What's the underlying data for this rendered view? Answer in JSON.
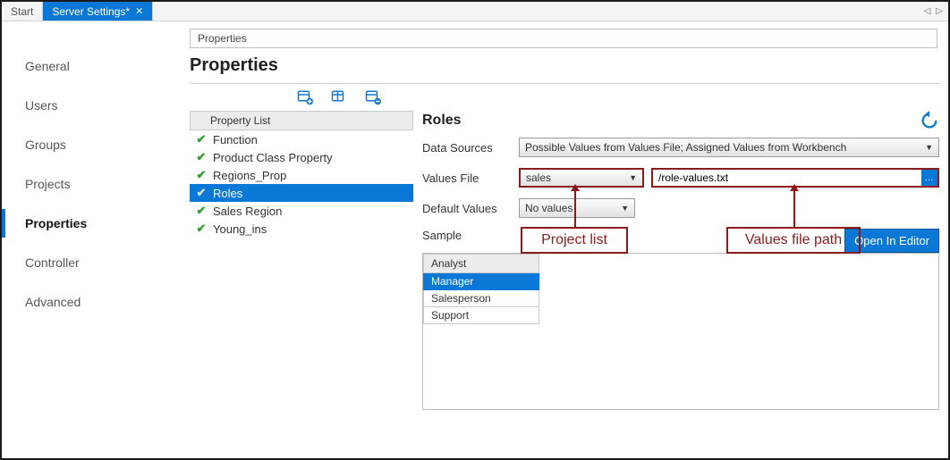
{
  "tabs": {
    "start": "Start",
    "settings": "Server Settings*"
  },
  "sidebar": {
    "items": [
      {
        "label": "General"
      },
      {
        "label": "Users"
      },
      {
        "label": "Groups"
      },
      {
        "label": "Projects"
      },
      {
        "label": "Properties"
      },
      {
        "label": "Controller"
      },
      {
        "label": "Advanced"
      }
    ],
    "active_index": 4
  },
  "breadcrumb": "Properties",
  "page_title": "Properties",
  "toolbar": {
    "add_icon": "add-table-icon",
    "edit_icon": "edit-table-icon",
    "remove_icon": "remove-table-icon"
  },
  "property_list": {
    "header": "Property List",
    "items": [
      {
        "label": "Function"
      },
      {
        "label": "Product Class Property"
      },
      {
        "label": "Regions_Prop"
      },
      {
        "label": "Roles"
      },
      {
        "label": "Sales Region"
      },
      {
        "label": "Young_ins"
      }
    ],
    "selected_index": 3
  },
  "detail": {
    "title": "Roles",
    "labels": {
      "data_sources": "Data Sources",
      "values_file": "Values File",
      "default_values": "Default Values",
      "sample": "Sample"
    },
    "data_sources_value": "Possible Values from Values File; Assigned Values from Workbench",
    "project_value": "sales",
    "path_value": "/role-values.txt",
    "default_values_value": "No values",
    "open_editor_label": "Open In Editor",
    "sample_header": "Analyst",
    "sample_items": [
      "Manager",
      "Salesperson",
      "Support"
    ],
    "sample_selected_index": 0
  },
  "annotations": {
    "project_list": "Project list",
    "values_file_path": "Values file path"
  }
}
